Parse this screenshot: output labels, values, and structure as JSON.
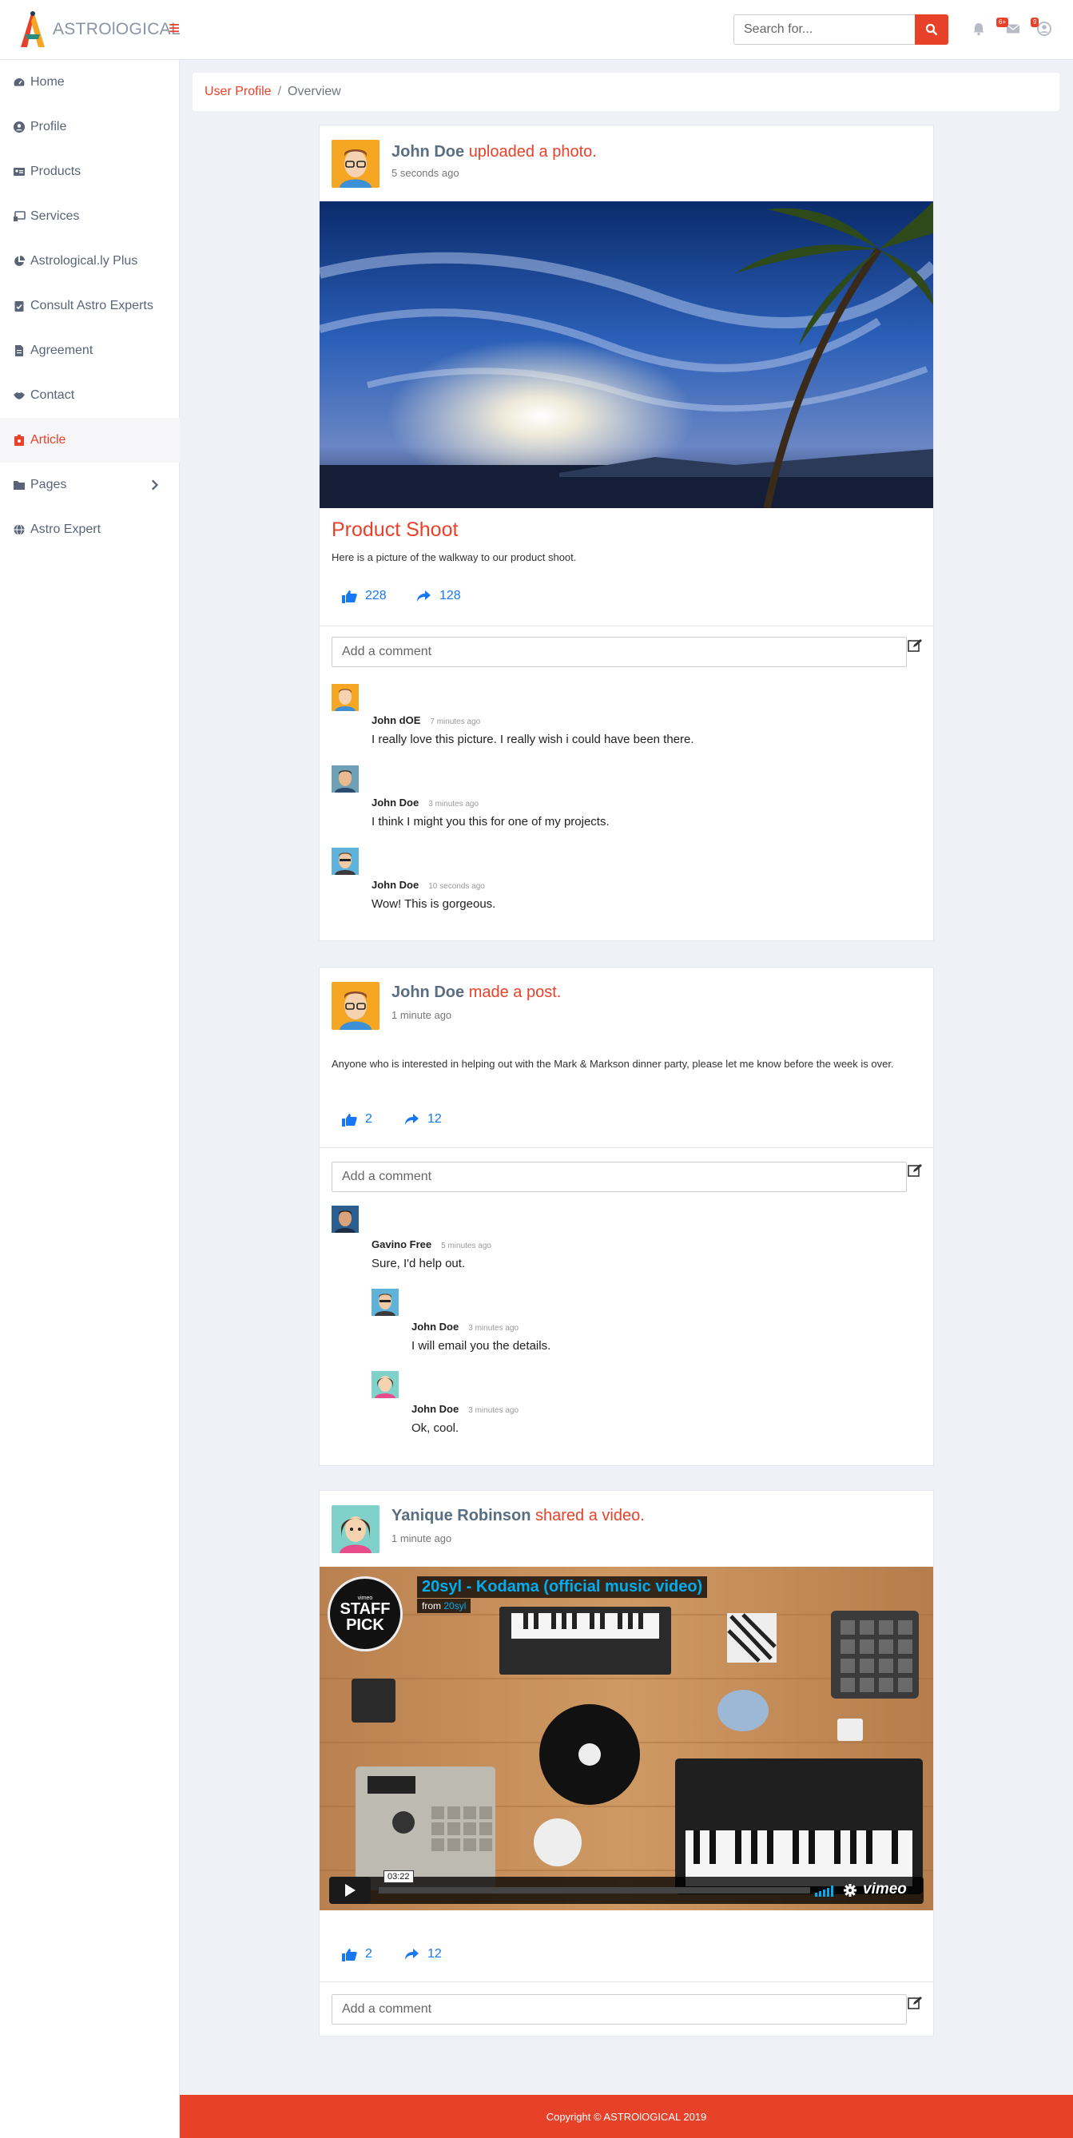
{
  "brand": {
    "name": "ASTROlOGICAL"
  },
  "search": {
    "placeholder": "Search for..."
  },
  "notifications": {
    "messages_badge": "6+",
    "alerts_badge": "9"
  },
  "sidebar": {
    "items": [
      {
        "label": "Home",
        "icon": "dashboard-icon"
      },
      {
        "label": "Profile",
        "icon": "user-circle-icon"
      },
      {
        "label": "Products",
        "icon": "id-card-icon"
      },
      {
        "label": "Services",
        "icon": "monitor-icon"
      },
      {
        "label": "Astrological.ly Plus",
        "icon": "pie-chart-icon"
      },
      {
        "label": "Consult Astro Experts",
        "icon": "clipboard-check-icon"
      },
      {
        "label": "Agreement",
        "icon": "file-icon"
      },
      {
        "label": "Contact",
        "icon": "handshake-icon"
      },
      {
        "label": "Article",
        "icon": "article-icon",
        "active": true
      },
      {
        "label": "Pages",
        "icon": "folder-icon"
      },
      {
        "label": "Astro Expert",
        "icon": "globe-icon"
      }
    ]
  },
  "breadcrumb": {
    "link": "User Profile",
    "separator": "/",
    "current": "Overview"
  },
  "posts": [
    {
      "name": "John Doe",
      "action": "uploaded a photo.",
      "time": "5 seconds ago",
      "title": "Product Shoot",
      "text": "Here is a picture of the walkway to our product shoot.",
      "likes": "228",
      "shares": "128",
      "comment_placeholder": "Add a comment",
      "comments": [
        {
          "name": "John dOE",
          "time": "7 minutes ago",
          "text": "I really love this picture. I really wish i could have been there."
        },
        {
          "name": "John Doe",
          "time": "3 minutes ago",
          "text": "I think I might you this for one of my projects."
        },
        {
          "name": "John Doe",
          "time": "10 seconds ago",
          "text": "Wow! This is gorgeous."
        }
      ]
    },
    {
      "name": "John Doe",
      "action": "made a post.",
      "time": "1 minute ago",
      "text": "Anyone who is interested in helping out with the Mark & Markson dinner party, please let me know before the week is over.",
      "likes": "2",
      "shares": "12",
      "comment_placeholder": "Add a comment",
      "comments": [
        {
          "name": "Gavino Free",
          "time": "5 minutes ago",
          "text": "Sure, I'd help out."
        },
        {
          "name": "John Doe",
          "time": "3 minutes ago",
          "text": "I will email you the details."
        },
        {
          "name": "John Doe",
          "time": "3 minutes ago",
          "text": "Ok, cool."
        }
      ]
    },
    {
      "name": "Yanique Robinson",
      "action": "shared a video.",
      "time": "1 minute ago",
      "video": {
        "title": "20syl - Kodama (official music video)",
        "from_label": "from",
        "from_user": "20syl",
        "staff_pick": "STAFF PICK",
        "vimeo_small": "vimeo",
        "duration": "03:22",
        "vimeo_logo": "vimeo"
      },
      "likes": "2",
      "shares": "12",
      "comment_placeholder": "Add a comment"
    }
  ],
  "footer": {
    "text": "Copyright © ASTROlOGICAL 2019"
  }
}
